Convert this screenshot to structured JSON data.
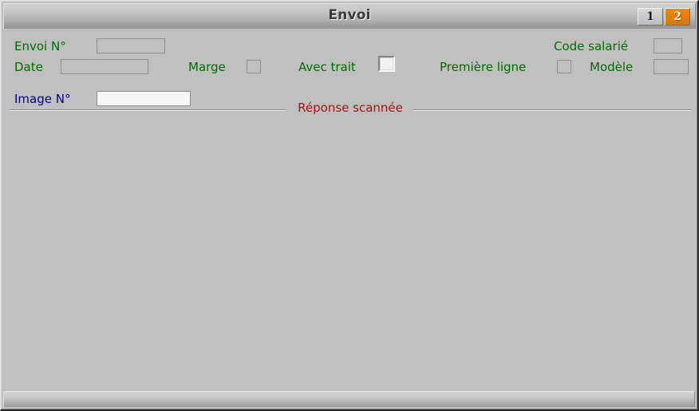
{
  "window": {
    "title": "Envoi"
  },
  "tabs": [
    {
      "label": "1",
      "state": "inactive"
    },
    {
      "label": "2",
      "state": "active"
    }
  ],
  "colors": {
    "label_green": "#006b00",
    "label_navy": "#000080",
    "group_red": "#9e1414",
    "tab_active_bg": "#d97706",
    "window_bg": "#c0c0c0"
  },
  "form": {
    "fields": [
      {
        "label": "Envoi N°",
        "value": "",
        "type": "text",
        "enabled": false
      },
      {
        "label": "Date",
        "value": "",
        "type": "text",
        "enabled": false
      },
      {
        "label": "Marge",
        "value": "",
        "type": "checkbox",
        "enabled": false
      },
      {
        "label": "Avec trait",
        "value": "",
        "type": "checkbox",
        "enabled": true
      },
      {
        "label": "Première ligne",
        "value": "",
        "type": "checkbox",
        "enabled": false
      },
      {
        "label": "Code salarié",
        "value": "",
        "type": "text",
        "enabled": false
      },
      {
        "label": "Modèle",
        "value": "",
        "type": "text",
        "enabled": false
      }
    ]
  },
  "group": {
    "title": "Réponse scannée",
    "fields": [
      {
        "label": "Image N°",
        "value": "",
        "type": "text",
        "enabled": true
      }
    ]
  }
}
